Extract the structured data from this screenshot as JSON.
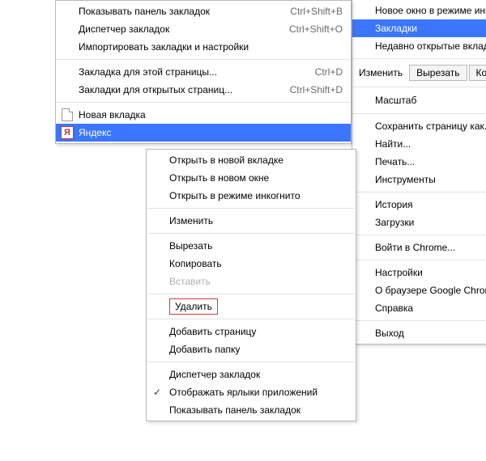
{
  "main_menu": {
    "new_incognito": "Новое окно в режиме инкогн",
    "bookmarks": "Закладки",
    "recent_tabs": "Недавно открытые вкладки",
    "edit_label": "Изменить",
    "cut_btn": "Вырезать",
    "copy_btn": "Копи",
    "scale": "Масштаб",
    "save_as": "Сохранить страницу как...",
    "find": "Найти...",
    "print": "Печать...",
    "tools": "Инструменты",
    "history": "История",
    "downloads": "Загрузки",
    "signin": "Войти в Chrome...",
    "settings": "Настройки",
    "about": "О браузере Google Chrome",
    "help": "Справка",
    "exit": "Выход"
  },
  "bm_menu": {
    "show_bar": {
      "label": "Показывать панель закладок",
      "short": "Ctrl+Shift+B"
    },
    "manager": {
      "label": "Диспетчер закладок",
      "short": "Ctrl+Shift+O"
    },
    "import": {
      "label": "Импортировать закладки и настройки"
    },
    "this_page": {
      "label": "Закладка для этой страницы...",
      "short": "Ctrl+D"
    },
    "open_tabs": {
      "label": "Закладки для открытых страниц...",
      "short": "Ctrl+Shift+D"
    },
    "new_tab": {
      "label": "Новая вкладка"
    },
    "yandex": {
      "label": "Яндекс"
    }
  },
  "yx_menu": {
    "open_tab": "Открыть в новой вкладке",
    "open_win": "Открыть в новом окне",
    "open_inc": "Открыть в режиме инкогнито",
    "edit": "Изменить",
    "cut": "Вырезать",
    "copy": "Копировать",
    "paste": "Вставить",
    "delete": "Удалить",
    "add_page": "Добавить страницу",
    "add_folder": "Добавить папку",
    "manager": "Диспетчер закладок",
    "show_apps": "Отображать ярлыки приложений",
    "show_bar": "Показывать панель закладок"
  },
  "icons": {
    "ya_letter": "Я"
  }
}
